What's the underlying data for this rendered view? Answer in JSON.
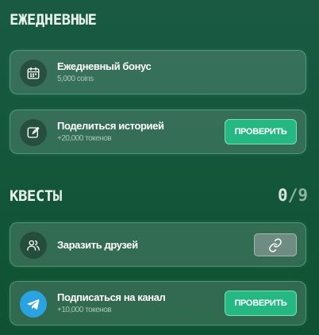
{
  "daily": {
    "title": "ЕЖЕДНЕВНЫЕ",
    "items": [
      {
        "icon": "calendar-icon",
        "title": "Ежедневный бонус",
        "subtitle": "5,000 coins"
      },
      {
        "icon": "edit-icon",
        "title": "Поделиться историей",
        "subtitle": "+20,000 токенов",
        "button_label": "ПРОВЕРИТЬ"
      }
    ]
  },
  "quests": {
    "title": "КВЕСТЫ",
    "progress": {
      "done": "0",
      "separator": "/",
      "total": "9"
    },
    "items": [
      {
        "icon": "users-icon",
        "title": "Заразить друзей",
        "button_icon": "link-icon"
      },
      {
        "icon": "telegram-icon",
        "title": "Подписаться на канал",
        "subtitle": "+10,000 токенов",
        "button_label": "ПРОВЕРИТЬ"
      }
    ]
  },
  "colors": {
    "background": "#14573c",
    "accent_button": "#26b883",
    "link_button": "#6e8c81",
    "telegram": "#2aa3e0"
  }
}
